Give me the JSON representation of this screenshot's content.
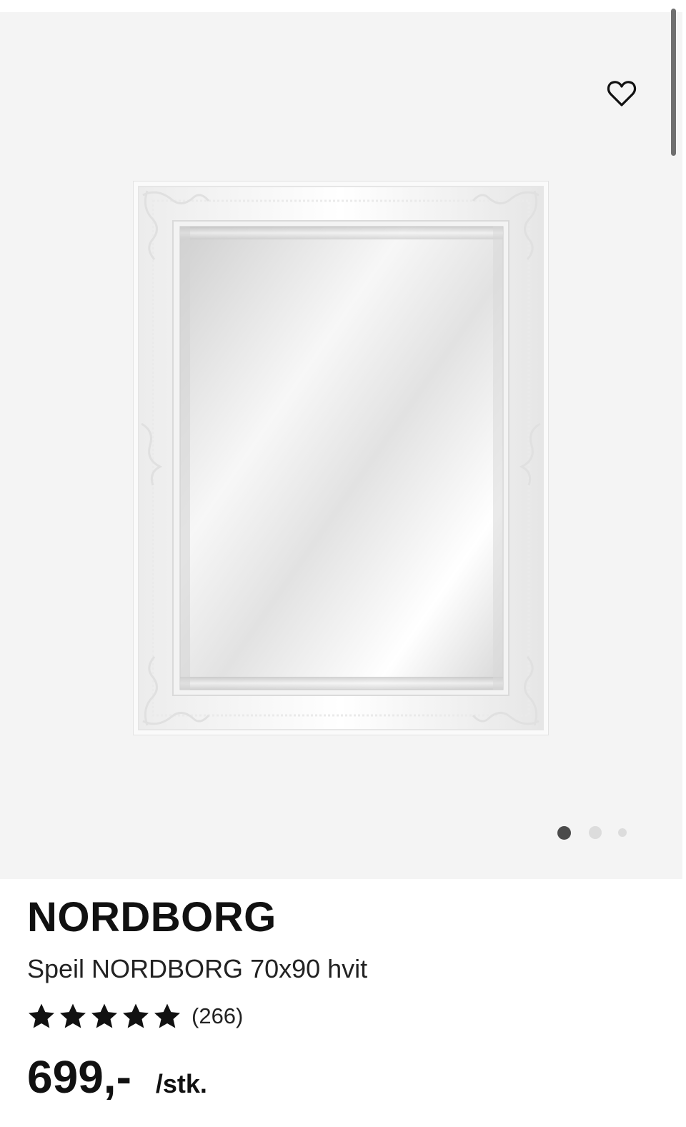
{
  "product": {
    "brand": "NORDBORG",
    "name": "Speil NORDBORG 70x90 hvit",
    "rating": 5,
    "rating_max": 5,
    "review_count": "(266)",
    "price": "699,-",
    "unit": "/stk."
  },
  "gallery": {
    "image_count": 3,
    "active_index": 1,
    "background_color": "#f4f4f4"
  },
  "icons": {
    "favorite": "heart-outline-icon",
    "star": "star-icon"
  },
  "colors": {
    "text": "#111111",
    "dot_active": "#4b4b4b",
    "dot_inactive": "#dcdcdc"
  }
}
